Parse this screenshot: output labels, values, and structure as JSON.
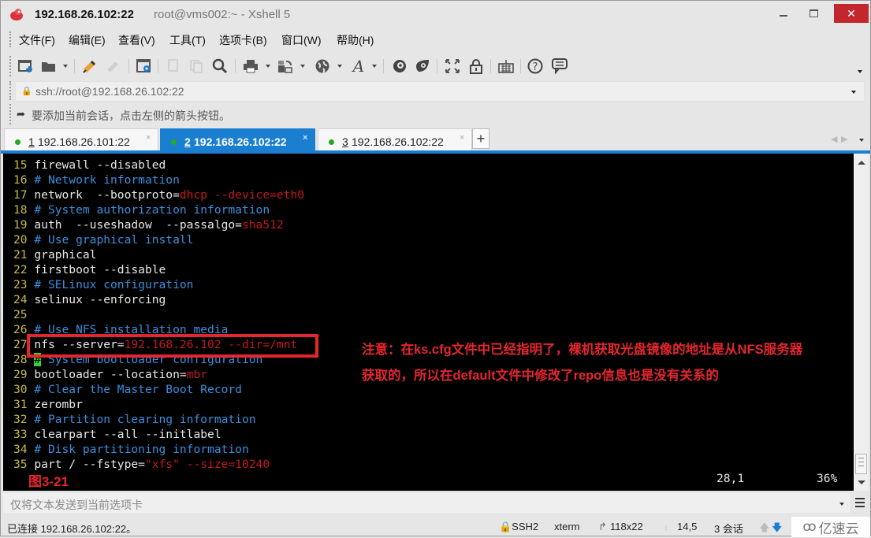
{
  "window": {
    "title_host": "192.168.26.102:22",
    "title_rest": "root@vms002:~ - Xshell 5",
    "close_glyph": "✕"
  },
  "menu": [
    "文件(F)",
    "编辑(E)",
    "查看(V)",
    "工具(T)",
    "选项卡(B)",
    "窗口(W)",
    "帮助(H)"
  ],
  "toolbar": {
    "icons": [
      {
        "name": "new-session-icon",
        "glyph": "⊞"
      },
      {
        "name": "open-folder-icon",
        "glyph": "▬"
      },
      {
        "name": "connect-icon",
        "glyph": "✎"
      },
      {
        "name": "disconnect-icon",
        "glyph": "✎"
      },
      {
        "name": "properties-icon",
        "glyph": "⚙"
      },
      {
        "name": "copy-icon",
        "glyph": "❐"
      },
      {
        "name": "paste-icon",
        "glyph": "❐"
      },
      {
        "name": "find-icon",
        "glyph": "🔍"
      },
      {
        "name": "print-icon",
        "glyph": "⎙"
      },
      {
        "name": "transfer-icon",
        "glyph": "⇄"
      },
      {
        "name": "globe-icon",
        "glyph": "◍"
      },
      {
        "name": "font-icon",
        "glyph": "A"
      },
      {
        "name": "xftp-icon",
        "glyph": "◉"
      },
      {
        "name": "xmanager-icon",
        "glyph": "◈"
      },
      {
        "name": "fullscreen-icon",
        "glyph": "⤢"
      },
      {
        "name": "lock-icon",
        "glyph": "🔒"
      },
      {
        "name": "keyboard-icon",
        "glyph": "⌨"
      },
      {
        "name": "help-icon",
        "glyph": "?"
      },
      {
        "name": "chat-icon",
        "glyph": "💬"
      }
    ]
  },
  "address": {
    "lock_glyph": "🔒",
    "value": "ssh://root@192.168.26.102:22"
  },
  "hint": {
    "icon_glyph": "➦",
    "text": "要添加当前会话，点击左侧的箭头按钮。"
  },
  "tabs": [
    {
      "num": "1",
      "label": "192.168.26.101:22",
      "active": false
    },
    {
      "num": "2",
      "label": "192.168.26.102:22",
      "active": true
    },
    {
      "num": "3",
      "label": "192.168.26.102:22",
      "active": false
    }
  ],
  "tab_close_glyph": "×",
  "tab_add_glyph": "+",
  "tab_nav": {
    "prev": "◀",
    "next": "▶"
  },
  "terminal": {
    "lines": [
      {
        "n": "15",
        "parts": [
          {
            "t": "firewall --disabled",
            "c": ""
          }
        ]
      },
      {
        "n": "16",
        "parts": [
          {
            "t": "# Network information",
            "c": "cm"
          }
        ]
      },
      {
        "n": "17",
        "parts": [
          {
            "t": "network  --bootproto=",
            "c": ""
          },
          {
            "t": "dhcp --device=eth0",
            "c": "rd"
          }
        ]
      },
      {
        "n": "18",
        "parts": [
          {
            "t": "# System authorization information",
            "c": "cm"
          }
        ]
      },
      {
        "n": "19",
        "parts": [
          {
            "t": "auth  --useshadow  --passalgo=",
            "c": ""
          },
          {
            "t": "sha512",
            "c": "rd"
          }
        ]
      },
      {
        "n": "20",
        "parts": [
          {
            "t": "# Use graphical install",
            "c": "cm"
          }
        ]
      },
      {
        "n": "21",
        "parts": [
          {
            "t": "graphical",
            "c": ""
          }
        ]
      },
      {
        "n": "22",
        "parts": [
          {
            "t": "firstboot --disable",
            "c": ""
          }
        ]
      },
      {
        "n": "23",
        "parts": [
          {
            "t": "# SELinux configuration",
            "c": "cm"
          }
        ]
      },
      {
        "n": "24",
        "parts": [
          {
            "t": "selinux --enforcing",
            "c": ""
          }
        ]
      },
      {
        "n": "25",
        "parts": []
      },
      {
        "n": "26",
        "parts": [
          {
            "t": "# Use NFS installation media",
            "c": "cm"
          }
        ]
      },
      {
        "n": "27",
        "parts": [
          {
            "t": "nfs --server=",
            "c": ""
          },
          {
            "t": "192.168.26.102 --dir=/mnt",
            "c": "rd"
          }
        ]
      },
      {
        "n": "28",
        "parts": [
          {
            "t": "#",
            "c": "cursor"
          },
          {
            "t": " System bootloader configuration",
            "c": "cm"
          }
        ]
      },
      {
        "n": "29",
        "parts": [
          {
            "t": "bootloader --location=",
            "c": ""
          },
          {
            "t": "mbr",
            "c": "rd"
          }
        ]
      },
      {
        "n": "30",
        "parts": [
          {
            "t": "# Clear the Master Boot Record",
            "c": "cm"
          }
        ]
      },
      {
        "n": "31",
        "parts": [
          {
            "t": "zerombr",
            "c": ""
          }
        ]
      },
      {
        "n": "32",
        "parts": [
          {
            "t": "# Partition clearing information",
            "c": "cm"
          }
        ]
      },
      {
        "n": "33",
        "parts": [
          {
            "t": "clearpart --all --initlabel",
            "c": ""
          }
        ]
      },
      {
        "n": "34",
        "parts": [
          {
            "t": "# Disk partitioning information",
            "c": "cm"
          }
        ]
      },
      {
        "n": "35",
        "parts": [
          {
            "t": "part / --fstype=",
            "c": ""
          },
          {
            "t": "\"xfs\" --size=10240",
            "c": "rd"
          }
        ]
      }
    ],
    "annotation_line1": "注意：在ks.cfg文件中已经指明了，裸机获取光盘镜像的地址是从NFS服务器",
    "annotation_line2": "获取的，所以在default文件中修改了repo信息也是没有关系的",
    "figure_label": "图3-21",
    "cursor_position": "28,1",
    "scroll_percent": "36%"
  },
  "compose": {
    "placeholder": "仅将文本发送到当前选项卡"
  },
  "status": {
    "connection": "已连接 192.168.26.102:22。",
    "protocol": "🔒SSH2",
    "terminal_type": "xterm",
    "size_icon": "↱",
    "size": "118x22",
    "cursor_icon": "⦙",
    "cursor": "14,5",
    "sessions": "3 会话",
    "up_arrow": "🡅",
    "down_arrow": "🡇",
    "brand_logo": "ꝏ",
    "brand": "亿速云"
  },
  "colors": {
    "accent": "#1a7ed1",
    "close": "#c1272d",
    "annotation": "#e4262e",
    "line_number": "#c9b94a",
    "comment": "#3b8fde",
    "value": "#c41a1a"
  }
}
